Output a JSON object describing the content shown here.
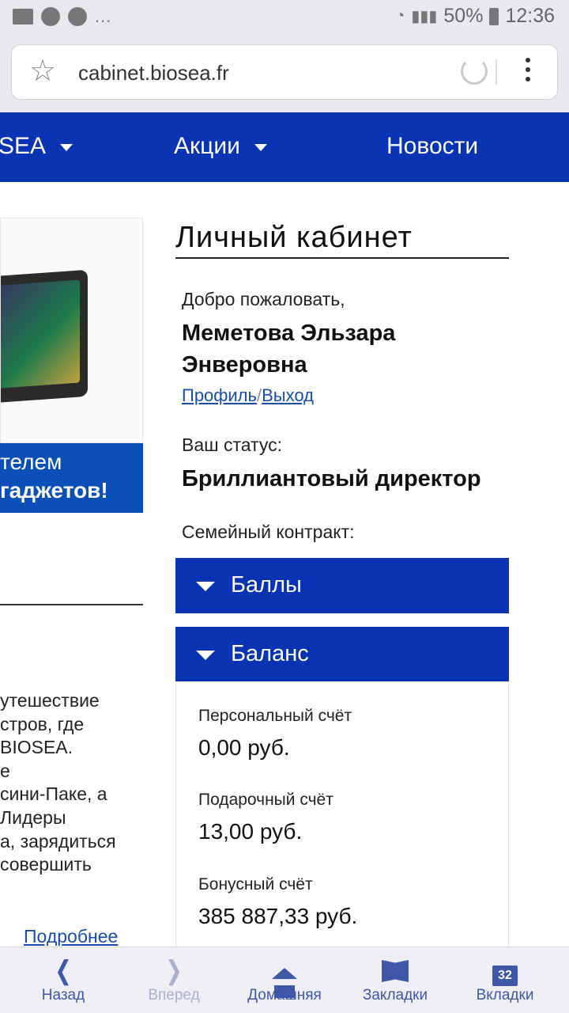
{
  "statusbar": {
    "battery": "50%",
    "time": "12:36",
    "more": "..."
  },
  "browser": {
    "url": "cabinet.biosea.fr"
  },
  "nav": {
    "items": [
      {
        "label": "SEA"
      },
      {
        "label": "Акции"
      },
      {
        "label": "Новости"
      }
    ]
  },
  "promo": {
    "line1": "телем",
    "line2": "гаджетов!",
    "text_lines": [
      "утешествие",
      "стров, где",
      "BIOSEA.",
      "е",
      "сини-Паке, а",
      "Лидеры",
      "а, зарядиться",
      "совершить"
    ],
    "more_link": "Подробнее"
  },
  "cabinet": {
    "title": "Личный кабинет",
    "welcome": "Добро пожаловать,",
    "username": "Меметова Эльзара Энверовна",
    "profile_link": "Профиль",
    "separator": "/",
    "logout_link": "Выход",
    "status_label": "Ваш статус:",
    "status_value": "Бриллиантовый директор",
    "family_label": "Семейный контракт:"
  },
  "accordions": {
    "points": "Баллы",
    "balance": "Баланс"
  },
  "balance": {
    "personal_label": "Персональный счёт",
    "personal_value": "0,00 руб.",
    "gift_label": "Подарочный счёт",
    "gift_value": "13,00 руб.",
    "bonus_label": "Бонусный счёт",
    "bonus_value": "385 887,33 руб."
  },
  "toolbar": {
    "back": "Назад",
    "forward": "Вперед",
    "home": "Домашняя",
    "bookmarks": "Закладки",
    "tabs": "Вкладки",
    "tabs_count": "32"
  },
  "colors": {
    "brand_blue": "#0833b3",
    "link_blue": "#1a4bb0",
    "toolbar_icon": "#3e57a8"
  }
}
